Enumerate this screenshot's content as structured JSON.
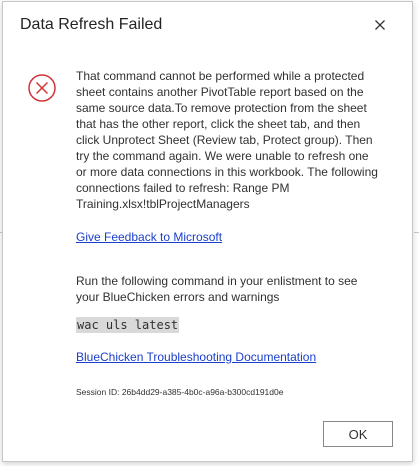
{
  "dialog": {
    "title": "Data Refresh Failed",
    "close_icon": "close-icon",
    "error_icon": "error-circle-x-icon",
    "error_color": "#d13438",
    "message": "That command cannot be performed while a protected sheet contains another PivotTable report based on the same source data.To remove protection from the sheet that has the other report, click the sheet tab, and then click Unprotect Sheet (Review tab, Protect group). Then try the command again. We were unable to refresh one or more data connections in this workbook. The following connections failed to refresh: Range PM Training.xlsx!tblProjectManagers",
    "feedback_link": "Give Feedback to Microsoft",
    "run_text": "Run the following command in your enlistment to see your BlueChicken errors and warnings",
    "command": "wac uls latest",
    "troubleshoot_link": "BlueChicken Troubleshooting Documentation",
    "session_id": "Session ID: 26b4dd29-a385-4b0c-a96a-b300cd191d0e",
    "ok_label": "OK",
    "link_color": "#1a3fcc"
  }
}
